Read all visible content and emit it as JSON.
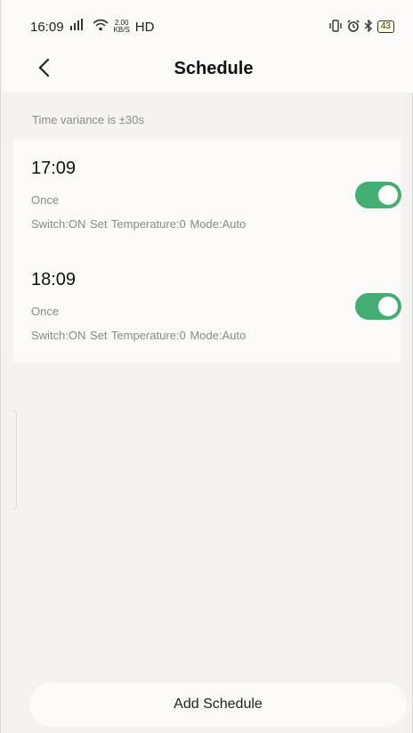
{
  "status_bar": {
    "time": "16:09",
    "signal": "4G signal",
    "net_speed_top": "2.00",
    "net_speed_bottom": "KB/S",
    "hd": "HD",
    "battery": "43"
  },
  "header": {
    "title": "Schedule"
  },
  "info": {
    "variance": "Time variance is ±30s"
  },
  "schedules": [
    {
      "time": "17:09",
      "repeat": "Once",
      "detail": "Switch:ON  Set Temperature:0  Mode:Auto",
      "enabled": true
    },
    {
      "time": "18:09",
      "repeat": "Once",
      "detail": "Switch:ON  Set Temperature:0  Mode:Auto",
      "enabled": true
    }
  ],
  "footer": {
    "add_label": "Add Schedule"
  },
  "colors": {
    "toggle_on": "#44ad74",
    "background": "#f4f3f1",
    "card": "#fbfaf8"
  }
}
